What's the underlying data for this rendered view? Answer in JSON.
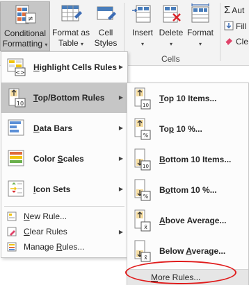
{
  "ribbon": {
    "conditional_formatting": {
      "line1": "Conditional",
      "line2": "Formatting"
    },
    "format_as_table": {
      "line1": "Format as",
      "line2": "Table"
    },
    "cell_styles": {
      "line1": "Cell",
      "line2": "Styles"
    },
    "insert": "Insert",
    "delete": "Delete",
    "format": "Format",
    "cells_group": "Cells",
    "autosum": "Aut",
    "fill": "Fill",
    "clear": "Cle"
  },
  "main_menu": {
    "items": [
      {
        "label": "Highlight Cells Rules",
        "underline": "H",
        "rest": "ighlight Cells Rules",
        "icon": "highlight-cells-icon"
      },
      {
        "label": "Top/Bottom Rules",
        "underline": "T",
        "rest": "op/Bottom Rules",
        "icon": "top-bottom-icon"
      },
      {
        "label": "Data Bars",
        "underline": "D",
        "rest": "ata Bars",
        "icon": "data-bars-icon"
      },
      {
        "label": "Color Scales",
        "underline": "S",
        "pre": "Color ",
        "rest": "cales",
        "icon": "color-scales-icon"
      },
      {
        "label": "Icon Sets",
        "underline": "I",
        "rest": "con Sets",
        "icon": "icon-sets-icon"
      }
    ],
    "new_rule": {
      "pre": "",
      "ul": "N",
      "rest": "ew Rule..."
    },
    "clear_rules": {
      "pre": "",
      "ul": "C",
      "rest": "lear Rules"
    },
    "manage_rules": {
      "pre": "Manage ",
      "ul": "R",
      "rest": "ules..."
    }
  },
  "sub_menu": {
    "items": [
      {
        "pre": "",
        "ul": "T",
        "rest": "op 10 Items...",
        "tag": "10"
      },
      {
        "pre": "To",
        "ul": "p",
        "rest": " 10 %...",
        "tag": "%"
      },
      {
        "pre": "",
        "ul": "B",
        "rest": "ottom 10 Items...",
        "tag": "10"
      },
      {
        "pre": "B",
        "ul": "o",
        "rest": "ttom 10 %...",
        "tag": "%"
      },
      {
        "pre": "",
        "ul": "A",
        "rest": "bove Average...",
        "tag": "x̄"
      },
      {
        "pre": "Below ",
        "ul": "A",
        "rest": "verage...",
        "tag": "x̄"
      }
    ],
    "more_rules": {
      "pre": "",
      "ul": "M",
      "rest": "ore Rules..."
    }
  },
  "colors": {
    "accent_highlight": "#e01b1b",
    "selected_bg": "#c6c6c6"
  }
}
